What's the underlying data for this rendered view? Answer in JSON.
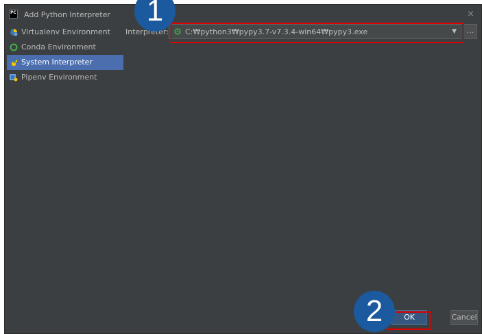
{
  "dialog": {
    "title": "Add Python Interpreter",
    "close_glyph": "×"
  },
  "sidebar": {
    "items": [
      {
        "label": "Virtualenv Environment",
        "icon": "virtualenv-icon",
        "selected": false
      },
      {
        "label": "Conda Environment",
        "icon": "conda-icon",
        "selected": false
      },
      {
        "label": "System Interpreter",
        "icon": "python-icon",
        "selected": true
      },
      {
        "label": "Pipenv Environment",
        "icon": "pipenv-icon",
        "selected": false
      }
    ]
  },
  "interpreter": {
    "label": "Interpreter:",
    "value": "C:₩python3₩pypy3.7-v7.3.4-win64₩pypy3.exe",
    "dropdown_glyph": "▼",
    "browse_label": "..."
  },
  "buttons": {
    "ok": "OK",
    "cancel": "Cancel"
  },
  "annotations": {
    "step1": "1",
    "step2": "2"
  },
  "colors": {
    "background": "#3c3f41",
    "selection": "#4b6eaf",
    "ok_button": "#365880",
    "highlight": "#e00000",
    "marker": "#1b5a9e"
  }
}
